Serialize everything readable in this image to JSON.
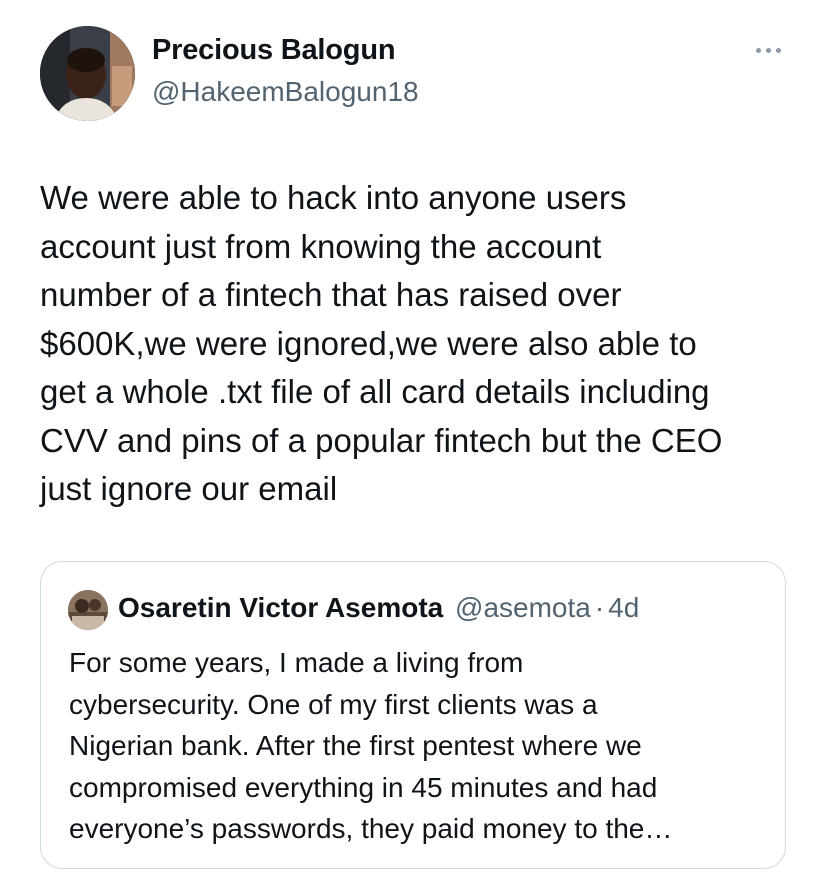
{
  "tweet": {
    "author_name": "Precious Balogun",
    "author_handle": "@HakeemBalogun18",
    "more_icon": "more-horizontal-icon",
    "text_lines": [
      "We were able to hack into anyone users",
      "account just from knowing the account",
      "number of a fintech that has raised over",
      "$600K,we were ignored,we were also able to",
      "get a whole .txt file of all card details including",
      "CVV and pins of a popular fintech but the CEO",
      "just ignore our email"
    ]
  },
  "quote": {
    "author_name": "Osaretin Victor Asemota",
    "author_handle": "@asemota",
    "separator": "·",
    "time": "4d",
    "text_lines": [
      "For some years, I made a living from",
      "cybersecurity. One of my first clients was a",
      "Nigerian bank. After the first pentest where we",
      "compromised everything in 45 minutes and had",
      "everyone’s passwords, they paid money to the…"
    ]
  },
  "colors": {
    "text_primary": "#0f1419",
    "text_secondary": "#536471",
    "border": "#cfd9de"
  }
}
